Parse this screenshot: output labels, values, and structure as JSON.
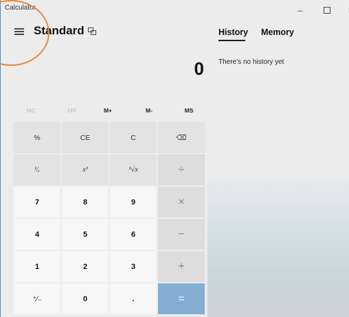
{
  "window": {
    "title": "Calculator",
    "minimize_glyph": "–",
    "close_glyph": "×"
  },
  "header": {
    "mode_title": "Standard"
  },
  "panel": {
    "tabs": [
      {
        "label": "History",
        "active": true
      },
      {
        "label": "Memory",
        "active": false
      }
    ],
    "empty_text": "There’s no history yet"
  },
  "display": {
    "value": "0"
  },
  "memory_row": [
    {
      "label": "MC",
      "enabled": false
    },
    {
      "label": "MR",
      "enabled": false
    },
    {
      "label": "M+",
      "enabled": true
    },
    {
      "label": "M-",
      "enabled": true
    },
    {
      "label": "MS",
      "enabled": true
    }
  ],
  "keypad": [
    [
      "%",
      "CE",
      "C",
      "⌫"
    ],
    [
      "¹⁄ₓ",
      "x²",
      "²√x",
      "÷"
    ],
    [
      "7",
      "8",
      "9",
      "×"
    ],
    [
      "4",
      "5",
      "6",
      "−"
    ],
    [
      "1",
      "2",
      "3",
      "+"
    ],
    [
      "⁺⁄₋",
      "0",
      ".",
      "="
    ]
  ],
  "colors": {
    "accent_equals": "#83aed3",
    "annotation_circle": "#e8893a",
    "window_border": "#3a8fd6"
  }
}
